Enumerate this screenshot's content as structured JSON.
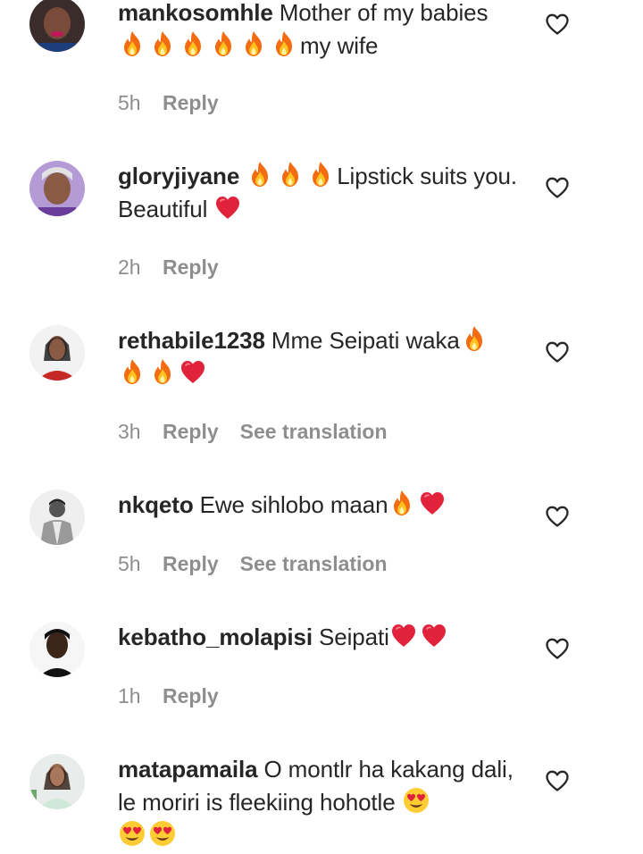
{
  "comments": [
    {
      "username": "mankosomhle",
      "text_before": "Mother of my babies",
      "emojis_line": [
        "fire",
        "fire",
        "fire",
        "fire",
        "fire",
        "fire"
      ],
      "text_after": "my wife",
      "time": "5h",
      "reply_label": "Reply",
      "translation_label": ""
    },
    {
      "username": "gloryjiyane",
      "emojis_inline": [
        "fire",
        "fire",
        "fire"
      ],
      "text": "Lipstick suits you. Beautiful",
      "trailing_emojis": [
        "red-heart"
      ],
      "time": "2h",
      "reply_label": "Reply",
      "translation_label": ""
    },
    {
      "username": "rethabile1238",
      "text": "Mme Seipati waka",
      "trailing_emojis": [
        "fire",
        "fire",
        "fire",
        "red-heart"
      ],
      "time": "3h",
      "reply_label": "Reply",
      "translation_label": "See translation"
    },
    {
      "username": "nkqeto",
      "text": "Ewe sihlobo maan",
      "trailing_emojis": [
        "fire",
        "red-heart"
      ],
      "time": "5h",
      "reply_label": "Reply",
      "translation_label": "See translation"
    },
    {
      "username": "kebatho_molapisi",
      "text": "Seipati",
      "trailing_emojis": [
        "red-heart",
        "red-heart"
      ],
      "time": "1h",
      "reply_label": "Reply",
      "translation_label": ""
    },
    {
      "username": "matapamaila",
      "text": "O montlr ha kakang dali, le moriri is fleekiing hohotle",
      "trailing_emojis": [
        "heart-eyes",
        "heart-eyes",
        "heart-eyes"
      ],
      "time": "",
      "reply_label": "",
      "translation_label": ""
    }
  ],
  "icons": {
    "like": "heart-outline-icon",
    "fire": "fire-emoji",
    "heart": "red-heart-emoji",
    "heart_eyes": "heart-eyes-emoji"
  },
  "colors": {
    "text": "#262626",
    "meta": "#8e8e8e",
    "heart": "#e0245e",
    "fire": "#f36c12"
  }
}
